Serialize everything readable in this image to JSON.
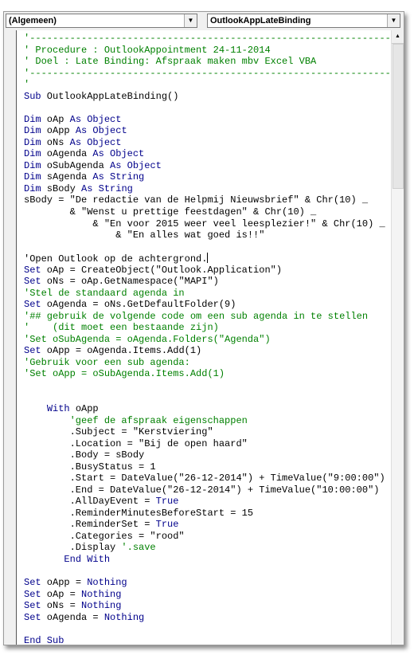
{
  "toolbar": {
    "object_combo": "(Algemeen)",
    "procedure_combo": "OutlookAppLateBinding",
    "dropdown_icon": "chevron-down-icon"
  },
  "colors": {
    "keyword": "#00008b",
    "comment": "#008000",
    "text": "#000000"
  },
  "code": [
    [
      {
        "t": "'-----------------------------------------------------------------",
        "c": "c"
      }
    ],
    [
      {
        "t": "' Procedure : OutlookAppointment 24-11-2014",
        "c": "c"
      }
    ],
    [
      {
        "t": "' Doel : Late Binding: Afspraak maken mbv Excel VBA",
        "c": "c"
      }
    ],
    [
      {
        "t": "'-----------------------------------------------------------------",
        "c": "c"
      }
    ],
    [
      {
        "t": "'",
        "c": "c"
      }
    ],
    [
      {
        "t": "Sub",
        "c": "k"
      },
      {
        "t": " OutlookAppLateBinding()",
        "c": "n"
      }
    ],
    [],
    [
      {
        "t": "Dim",
        "c": "k"
      },
      {
        "t": " oAp ",
        "c": "n"
      },
      {
        "t": "As Object",
        "c": "k"
      }
    ],
    [
      {
        "t": "Dim",
        "c": "k"
      },
      {
        "t": " oApp ",
        "c": "n"
      },
      {
        "t": "As Object",
        "c": "k"
      }
    ],
    [
      {
        "t": "Dim",
        "c": "k"
      },
      {
        "t": " oNs ",
        "c": "n"
      },
      {
        "t": "As Object",
        "c": "k"
      }
    ],
    [
      {
        "t": "Dim",
        "c": "k"
      },
      {
        "t": " oAgenda ",
        "c": "n"
      },
      {
        "t": "As Object",
        "c": "k"
      }
    ],
    [
      {
        "t": "Dim",
        "c": "k"
      },
      {
        "t": " oSubAgenda ",
        "c": "n"
      },
      {
        "t": "As Object",
        "c": "k"
      }
    ],
    [
      {
        "t": "Dim",
        "c": "k"
      },
      {
        "t": " sAgenda ",
        "c": "n"
      },
      {
        "t": "As String",
        "c": "k"
      }
    ],
    [
      {
        "t": "Dim",
        "c": "k"
      },
      {
        "t": " sBody ",
        "c": "n"
      },
      {
        "t": "As String",
        "c": "k"
      }
    ],
    [
      {
        "t": "sBody = \"De redactie van de Helpmij Nieuwsbrief\" & Chr(10) _",
        "c": "n"
      }
    ],
    [
      {
        "t": "        & \"Wenst u prettige feestdagen\" & Chr(10) _",
        "c": "n"
      }
    ],
    [
      {
        "t": "            & \"En voor 2015 weer veel leesplezier!\" & Chr(10) _",
        "c": "n"
      }
    ],
    [
      {
        "t": "                & \"En alles wat goed is!!\"",
        "c": "n"
      }
    ],
    [],
    [
      {
        "t": "'Open Outlook op de achtergrond.",
        "c": "n"
      }
    ],
    [
      {
        "t": "Set",
        "c": "k"
      },
      {
        "t": " oAp = CreateObject(\"Outlook.Application\")",
        "c": "n"
      }
    ],
    [
      {
        "t": "Set",
        "c": "k"
      },
      {
        "t": " oNs = oAp.GetNamespace(\"MAPI\")",
        "c": "n"
      }
    ],
    [
      {
        "t": "'Stel de standaard agenda in",
        "c": "c"
      }
    ],
    [
      {
        "t": "Set",
        "c": "k"
      },
      {
        "t": " oAgenda = oNs.GetDefaultFolder(9)",
        "c": "n"
      }
    ],
    [
      {
        "t": "'## gebruik de volgende code om een sub agenda in te stellen",
        "c": "c"
      }
    ],
    [
      {
        "t": "'    (dit moet een bestaande zijn)",
        "c": "c"
      }
    ],
    [
      {
        "t": "'Set oSubAgenda = oAgenda.Folders(\"Agenda\")",
        "c": "c"
      }
    ],
    [
      {
        "t": "Set",
        "c": "k"
      },
      {
        "t": " oApp = oAgenda.Items.Add(1)",
        "c": "n"
      }
    ],
    [
      {
        "t": "'Gebruik voor een sub agenda:",
        "c": "c"
      }
    ],
    [
      {
        "t": "'Set oApp = oSubAgenda.Items.Add(1)",
        "c": "c"
      }
    ],
    [],
    [],
    [
      {
        "t": "    ",
        "c": "n"
      },
      {
        "t": "With",
        "c": "k"
      },
      {
        "t": " oApp",
        "c": "n"
      }
    ],
    [
      {
        "t": "        ",
        "c": "n"
      },
      {
        "t": "'geef de afspraak eigenschappen",
        "c": "c"
      }
    ],
    [
      {
        "t": "        .Subject = \"Kerstviering\"",
        "c": "n"
      }
    ],
    [
      {
        "t": "        .Location = \"Bij de open haard\"",
        "c": "n"
      }
    ],
    [
      {
        "t": "        .Body = sBody",
        "c": "n"
      }
    ],
    [
      {
        "t": "        .BusyStatus = 1",
        "c": "n"
      }
    ],
    [
      {
        "t": "        .Start = DateValue(\"26-12-2014\") + TimeValue(\"9:00:00\")",
        "c": "n"
      }
    ],
    [
      {
        "t": "        .End = DateValue(\"26-12-2014\") + TimeValue(\"10:00:00\")",
        "c": "n"
      }
    ],
    [
      {
        "t": "        .AllDayEvent = ",
        "c": "n"
      },
      {
        "t": "True",
        "c": "k"
      }
    ],
    [
      {
        "t": "        .ReminderMinutesBeforeStart = 15",
        "c": "n"
      }
    ],
    [
      {
        "t": "        .ReminderSet = ",
        "c": "n"
      },
      {
        "t": "True",
        "c": "k"
      }
    ],
    [
      {
        "t": "        .Categories = \"rood\"",
        "c": "n"
      }
    ],
    [
      {
        "t": "        .Display ",
        "c": "n"
      },
      {
        "t": "'.save",
        "c": "c"
      }
    ],
    [
      {
        "t": "       ",
        "c": "n"
      },
      {
        "t": "End With",
        "c": "k"
      }
    ],
    [],
    [
      {
        "t": "Set",
        "c": "k"
      },
      {
        "t": " oApp = ",
        "c": "n"
      },
      {
        "t": "Nothing",
        "c": "k"
      }
    ],
    [
      {
        "t": "Set",
        "c": "k"
      },
      {
        "t": " oAp = ",
        "c": "n"
      },
      {
        "t": "Nothing",
        "c": "k"
      }
    ],
    [
      {
        "t": "Set",
        "c": "k"
      },
      {
        "t": " oNs = ",
        "c": "n"
      },
      {
        "t": "Nothing",
        "c": "k"
      }
    ],
    [
      {
        "t": "Set",
        "c": "k"
      },
      {
        "t": " oAgenda = ",
        "c": "n"
      },
      {
        "t": "Nothing",
        "c": "k"
      }
    ],
    [],
    [
      {
        "t": "End Sub",
        "c": "k"
      }
    ]
  ]
}
